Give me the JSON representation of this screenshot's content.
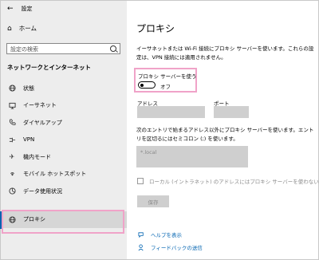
{
  "window": {
    "title": "設定"
  },
  "sidebar": {
    "home_label": "ホーム",
    "search_placeholder": "設定の検索",
    "section_title": "ネットワークとインターネット",
    "items": [
      {
        "label": "状態",
        "icon": "globe-icon"
      },
      {
        "label": "イーサネット",
        "icon": "monitor-icon"
      },
      {
        "label": "ダイヤルアップ",
        "icon": "phone-icon"
      },
      {
        "label": "VPN",
        "icon": "vpn-icon"
      },
      {
        "label": "機内モード",
        "icon": "airplane-icon"
      },
      {
        "label": "モバイル ホットスポット",
        "icon": "hotspot-icon"
      },
      {
        "label": "データ使用状況",
        "icon": "data-usage-icon"
      },
      {
        "label": "プロキシ",
        "icon": "globe-icon"
      }
    ],
    "active_index": 7
  },
  "main": {
    "title": "プロキシ",
    "description": "イーサネットまたは Wi-Fi 接続にプロキシ サーバーを使います。これらの設定は、VPN 接続には適用されません。",
    "use_proxy_label": "プロキシ サーバーを使う",
    "toggle_state": "オフ",
    "address_label": "アドレス",
    "port_label": "ポート",
    "exceptions_desc": "次のエントリで始まるアドレス以外にプロキシ サーバーを使います。エントリを区切るにはセミコロン (;) を使います。",
    "exceptions_value": "*.local",
    "local_checkbox_label": "ローカル (イントラネット) のアドレスにはプロキシ サーバーを使わない",
    "save_label": "保存",
    "help_link": "ヘルプを表示",
    "feedback_link": "フィードバックの送信"
  },
  "colors": {
    "accent": "#0063b1",
    "highlight": "#f0a3c8",
    "sidebar_bg": "#ededed",
    "field_bg": "#cfcfcf"
  }
}
